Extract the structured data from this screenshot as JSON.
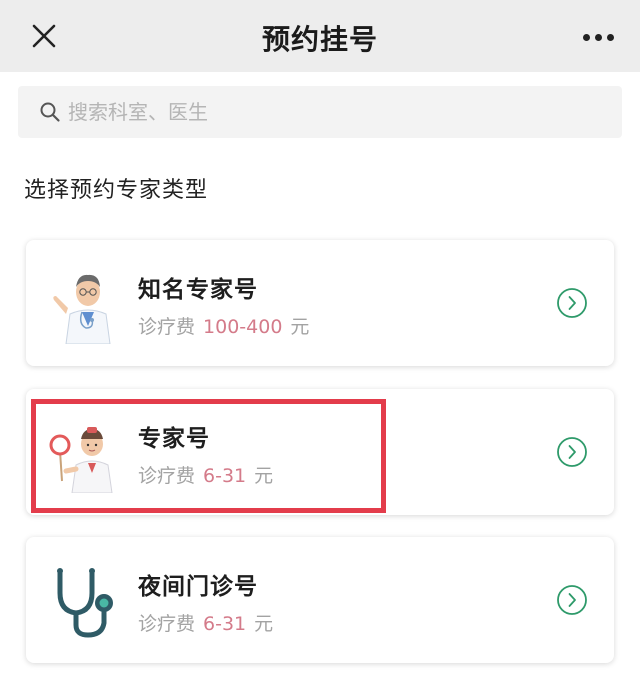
{
  "header": {
    "title": "预约挂号"
  },
  "search": {
    "placeholder": "搜索科室、医生"
  },
  "section": {
    "title": "选择预约专家类型"
  },
  "cards": [
    {
      "name": "知名专家号",
      "fee_label": "诊疗费",
      "fee_amount": "100-400",
      "fee_unit": "元",
      "icon": "doctor-presenting-icon"
    },
    {
      "name": "专家号",
      "fee_label": "诊疗费",
      "fee_amount": "6-31",
      "fee_unit": "元",
      "icon": "doctor-with-sign-icon"
    },
    {
      "name": "夜间门诊号",
      "fee_label": "诊疗费",
      "fee_amount": "6-31",
      "fee_unit": "元",
      "icon": "stethoscope-icon"
    }
  ],
  "colors": {
    "accent_green": "#2e9a6a",
    "fee_pink": "#d47b8a",
    "highlight_red": "#e33c4b"
  }
}
